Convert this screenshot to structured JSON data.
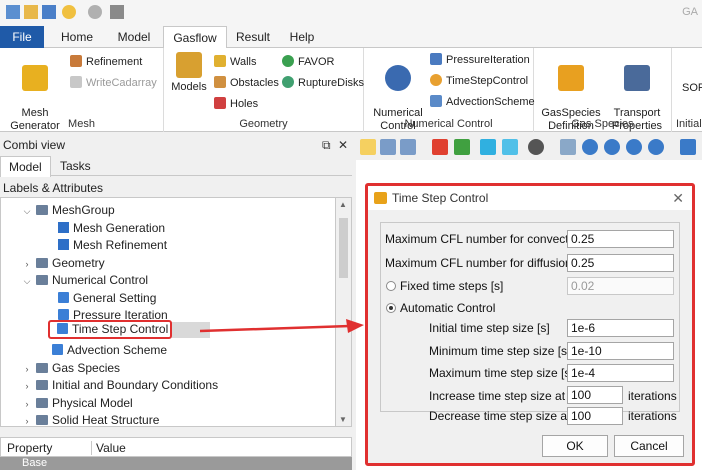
{
  "app_title_partial": "GA",
  "colors": {
    "accent": "#1f5aa8",
    "highlight": "#e03030"
  },
  "ribbon": {
    "tabs": [
      "File",
      "Home",
      "Model",
      "Gasflow",
      "Result",
      "Help"
    ],
    "active_tab": "Gasflow",
    "groups": {
      "mesh": {
        "label": "Mesh",
        "mesh_generator": "Mesh\nGenerator",
        "refinement": "Refinement",
        "write_cadarray": "WriteCadarray"
      },
      "geometry": {
        "label": "Geometry",
        "models": "Models",
        "walls": "Walls",
        "obstacles": "Obstacles",
        "holes": "Holes",
        "favor": "FAVOR",
        "rupture_disks": "RuptureDisks"
      },
      "numerical": {
        "label": "Numerical Control",
        "numerical_control": "Numerical\nControl",
        "pressure_iteration": "PressureIteration",
        "time_step_control": "TimeStepControl",
        "advection_scheme": "AdvectionScheme"
      },
      "gas_species": {
        "label": "Gas Species",
        "definition": "GasSpecies\nDefinition",
        "transport": "Transport\nProperties"
      },
      "initial": {
        "label": "Initial",
        "sor": "SOR"
      }
    }
  },
  "left_panel": {
    "title": "Combi view",
    "tabs": [
      "Model",
      "Tasks"
    ],
    "labels_header": "Labels & Attributes",
    "tree": [
      {
        "label": "MeshGroup",
        "level": 1,
        "expanded": true,
        "icon": "folder-icon"
      },
      {
        "label": "Mesh Generation",
        "level": 2,
        "icon": "cube-icon"
      },
      {
        "label": "Mesh Refinement",
        "level": 2,
        "icon": "cube-icon"
      },
      {
        "label": "Geometry",
        "level": 1,
        "expanded": false,
        "icon": "folder-icon"
      },
      {
        "label": "Numerical Control",
        "level": 1,
        "expanded": true,
        "icon": "folder-icon"
      },
      {
        "label": "General Setting",
        "level": 2,
        "icon": "list-icon"
      },
      {
        "label": "Pressure Iteration",
        "level": 2,
        "icon": "list-icon"
      },
      {
        "label": "Time Step Control",
        "level": 2,
        "icon": "list-icon",
        "selected": true
      },
      {
        "label": "Advection Scheme",
        "level": 2,
        "icon": "list-icon"
      },
      {
        "label": "Gas Species",
        "level": 1,
        "expanded": false,
        "icon": "folder-icon"
      },
      {
        "label": "Initial and Boundary Conditions",
        "level": 1,
        "expanded": false,
        "icon": "folder-icon"
      },
      {
        "label": "Physical Model",
        "level": 1,
        "expanded": false,
        "icon": "folder-icon"
      },
      {
        "label": "Solid Heat Structure",
        "level": 1,
        "expanded": false,
        "icon": "folder-icon"
      }
    ],
    "property_grid": {
      "col_property": "Property",
      "col_value": "Value",
      "group": "Base"
    }
  },
  "dialog": {
    "title": "Time Step Control",
    "close_glyph": "✕",
    "max_cfl_convection": {
      "label": "Maximum CFL number for convection",
      "value": "0.25"
    },
    "max_cfl_diffusion": {
      "label": "Maximum CFL number for diffusion",
      "value": "0.25"
    },
    "fixed_time_steps": {
      "label": "Fixed time steps [s]",
      "value": "0.02",
      "selected": false
    },
    "automatic_control": {
      "label": "Automatic Control",
      "selected": true
    },
    "initial_step": {
      "label": "Initial time step size [s]",
      "value": "1e-6"
    },
    "minimum_step": {
      "label": "Minimum time step size [s]",
      "value": "1e-10"
    },
    "maximum_step": {
      "label": "Maximum time step size [s]",
      "value": "1e-4"
    },
    "increase_at": {
      "label": "Increase time step size at <",
      "value": "100",
      "unit": "iterations"
    },
    "decrease_at": {
      "label": "Decrease time step size at >",
      "value": "100",
      "unit": "iterations"
    },
    "ok": "OK",
    "cancel": "Cancel"
  }
}
